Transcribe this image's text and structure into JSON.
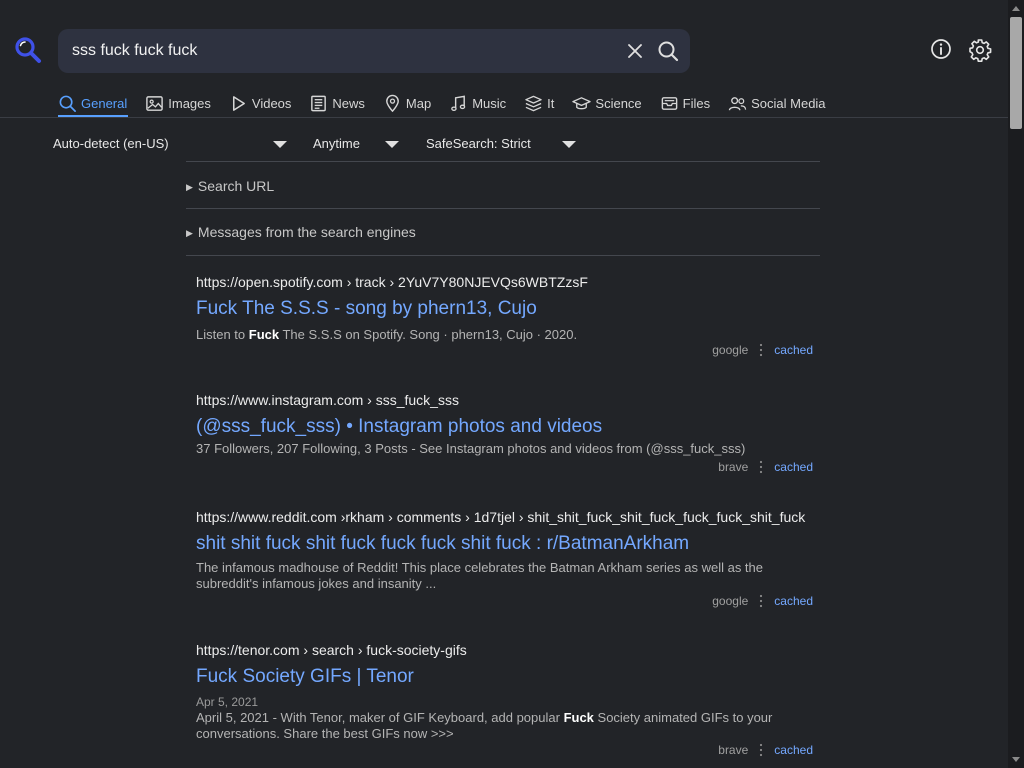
{
  "search": {
    "query": "sss fuck fuck fuck"
  },
  "tabs": [
    {
      "label": "General",
      "icon": "search-icon",
      "active": true
    },
    {
      "label": "Images",
      "icon": "image-icon"
    },
    {
      "label": "Videos",
      "icon": "play-icon"
    },
    {
      "label": "News",
      "icon": "newspaper-icon"
    },
    {
      "label": "Map",
      "icon": "map-pin-icon"
    },
    {
      "label": "Music",
      "icon": "music-note-icon"
    },
    {
      "label": "It",
      "icon": "stack-icon"
    },
    {
      "label": "Science",
      "icon": "graduation-cap-icon"
    },
    {
      "label": "Files",
      "icon": "inbox-icon"
    },
    {
      "label": "Social Media",
      "icon": "users-icon"
    }
  ],
  "filters": {
    "language": "Auto-detect (en-US)",
    "time": "Anytime",
    "safesearch": "SafeSearch: Strict"
  },
  "sections": {
    "search_url": "Search URL",
    "engine_messages": "Messages from the search engines"
  },
  "results": [
    {
      "url": "https://open.spotify.com  › track › 2YuV7Y80NJEVQs6WBTZzsF",
      "title": "Fuck The S.S.S - song by phern13, Cujo",
      "snippet_before": "Listen to ",
      "snippet_bold": "Fuck",
      "snippet_after": " The S.S.S on Spotify. Song · phern13, Cujo · 2020.",
      "engine": "google",
      "cached": "cached"
    },
    {
      "url": "https://www.instagram.com  › sss_fuck_sss",
      "title": "(@sss_fuck_sss) • Instagram photos and videos",
      "snippet": "37 Followers, 207 Following, 3 Posts - See Instagram photos and videos from (@sss_fuck_sss)",
      "engine": "brave",
      "cached": "cached"
    },
    {
      "url": "https://www.reddit.com  ›rkham › comments › 1d7tjel › shit_shit_fuck_shit_fuck_fuck_fuck_shit_fuck",
      "title": "shit shit fuck shit fuck fuck fuck shit fuck : r/BatmanArkham",
      "snippet": "The infamous madhouse of Reddit! This place celebrates the Batman Arkham series as well as the subreddit's infamous jokes and insanity ...",
      "engine": "google",
      "cached": "cached"
    },
    {
      "url": "https://tenor.com  › search › fuck-society-gifs",
      "title": "Fuck Society GIFs | Tenor",
      "date": "Apr 5, 2021",
      "snippet_before": "April 5, 2021 - With Tenor, maker of GIF Keyboard, add popular ",
      "snippet_bold": "Fuck",
      "snippet_after": " Society animated GIFs to your conversations. Share the best GIFs now >>>",
      "engine": "brave",
      "cached": "cached"
    }
  ],
  "colors": {
    "background": "#222428",
    "accent": "#58a0ff",
    "link": "#74a8ff",
    "logo": "#3f51e8"
  }
}
